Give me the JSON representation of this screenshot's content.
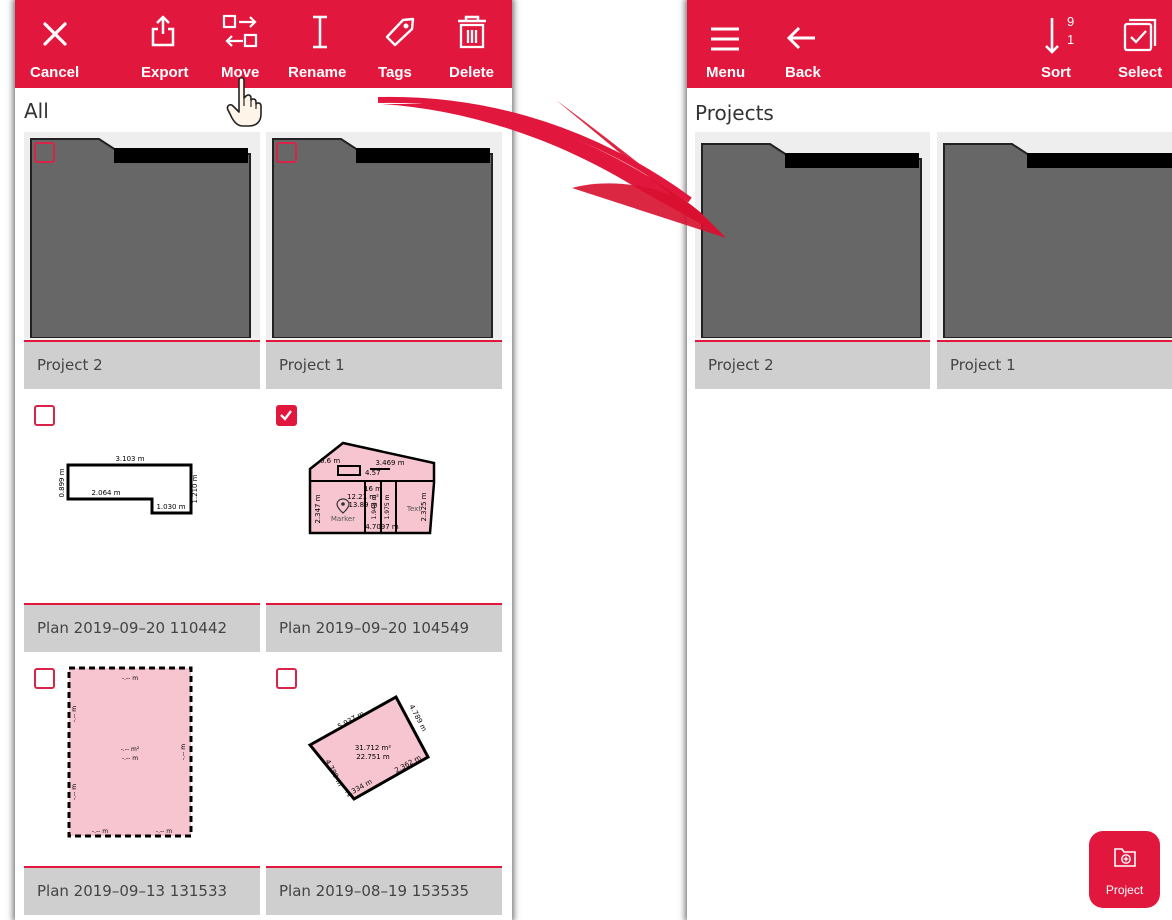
{
  "colors": {
    "brand_red": "#e2173d",
    "caption_gray": "#cfcfcf",
    "folder_gray": "#676767"
  },
  "left": {
    "toolbar": {
      "cancel": "Cancel",
      "export": "Export",
      "move": "Move",
      "rename": "Rename",
      "tags": "Tags",
      "delete": "Delete"
    },
    "section_title": "All",
    "items": [
      {
        "caption": "Project 2",
        "type": "folder",
        "checked": false
      },
      {
        "caption": "Project 1",
        "type": "folder",
        "checked": false
      },
      {
        "caption": "Plan 2019–09–20 110442",
        "type": "plan",
        "checked": false
      },
      {
        "caption": "Plan 2019–09–20 104549",
        "type": "plan",
        "checked": true
      },
      {
        "caption": "Plan 2019–09–13 131533",
        "type": "plan",
        "checked": false
      },
      {
        "caption": "Plan 2019–08–19 153535",
        "type": "plan",
        "checked": false
      }
    ],
    "plan1_labels": {
      "top": "3.103 m",
      "mid": "2.064 m",
      "left": "0.899 m",
      "right": "1.210 m",
      "bottom": "1.030 m"
    },
    "plan2_labels": {
      "a": "3.469 m",
      "b": "4.57",
      "c": "12.21 m²",
      "d": "13.89 m",
      "e": "2.347 m",
      "f": "1.948 m",
      "g": "1.975 m",
      "h": "2.325 m",
      "marker": "Marker",
      "text": "Text",
      "i": "4.7097 m",
      "j": "0.6 m",
      "k": "16 m"
    },
    "plan3_labels": {
      "top": "-.-- m",
      "area": "-.-- m²",
      "perim": "-.-- m",
      "bottom_left": "-.-- m",
      "bottom_right": "-.-- m",
      "left": "-.-- m",
      "left2": "-.-- m",
      "right": "-.-- m"
    },
    "plan4_labels": {
      "a": "5.937 m",
      "b": "4.789 m",
      "area": "31.712 m²",
      "perim": "22.751 m",
      "c": "4.789 m",
      "d": "2.334 m",
      "e": "2.362 m"
    },
    "icons": [
      "close-icon",
      "share-icon",
      "move-icon",
      "text-cursor-icon",
      "tag-icon",
      "trash-icon",
      "hand-pointer-icon"
    ]
  },
  "right": {
    "toolbar": {
      "menu": "Menu",
      "back": "Back",
      "sort": "Sort",
      "sort_top": "9",
      "sort_bottom": "1",
      "select": "Select"
    },
    "section_title": "Projects",
    "items": [
      {
        "caption": "Project 2",
        "type": "folder"
      },
      {
        "caption": "Project 1",
        "type": "folder"
      }
    ],
    "fab_label": "Project",
    "icons": [
      "hamburger-menu-icon",
      "arrow-left-icon",
      "sort-icon",
      "select-all-icon",
      "folder-add-icon"
    ]
  }
}
